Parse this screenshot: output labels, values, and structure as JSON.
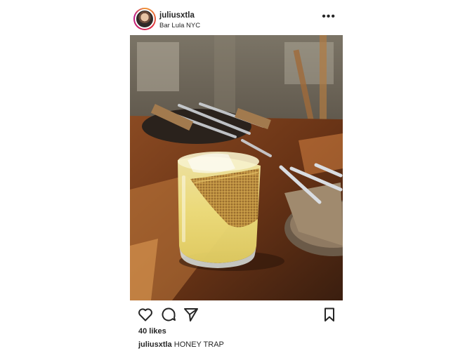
{
  "post": {
    "username": "juliusxtla",
    "location": "Bar Lula NYC",
    "more_icon": "more-horizontal-icon",
    "more_glyph": "•••",
    "image_description_tags": [
      "cocktail"
    ],
    "likes_text": "40 likes",
    "caption": {
      "username": "juliusxtla",
      "text": "HONEY TRAP"
    },
    "actions": {
      "like_icon": "heart-icon",
      "comment_icon": "comment-icon",
      "share_icon": "paper-plane-icon",
      "save_icon": "bookmark-icon"
    }
  }
}
